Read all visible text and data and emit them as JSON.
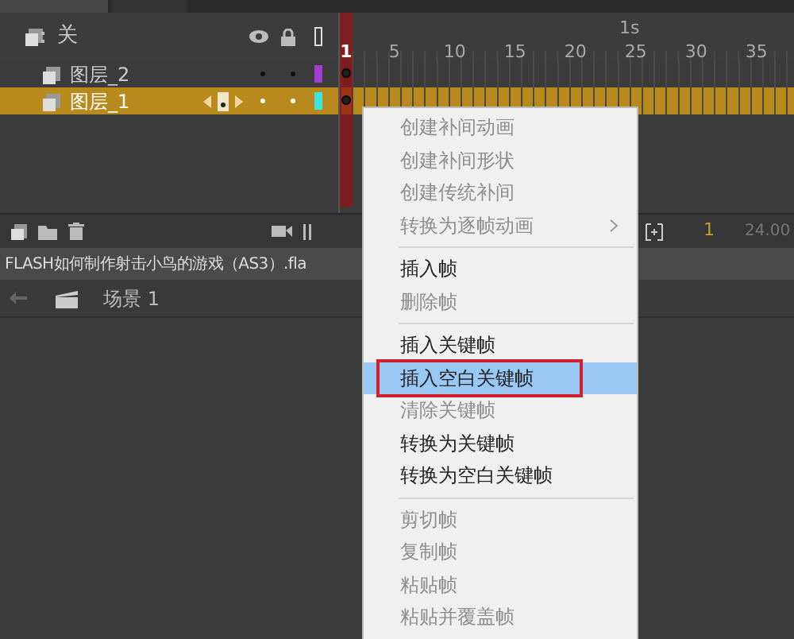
{
  "timeline": {
    "header_label": "关",
    "ruler": {
      "seconds_label": "1s",
      "frame_numbers": [
        "1",
        "5",
        "10",
        "15",
        "20",
        "25",
        "30",
        "35"
      ]
    },
    "layers": [
      {
        "name": "图层_2",
        "selected": false,
        "color": "#a23fd0"
      },
      {
        "name": "图层_1",
        "selected": true,
        "color": "#3fe3dc"
      }
    ],
    "toolbar": {
      "current_frame": "1",
      "frame_rate": "24.00"
    }
  },
  "document": {
    "title": "FLASH如何制作射击小鸟的游戏（AS3）.fla"
  },
  "breadcrumb": {
    "scene": "场景 1"
  },
  "context_menu": {
    "items": [
      {
        "kind": "item",
        "label": "创建补间动画",
        "disabled": true,
        "selected": false
      },
      {
        "kind": "item",
        "label": "创建补间形状",
        "disabled": true,
        "selected": false
      },
      {
        "kind": "item",
        "label": "创建传统补间",
        "disabled": true,
        "selected": false
      },
      {
        "kind": "submenu",
        "label": "转换为逐帧动画",
        "disabled": true,
        "selected": false
      },
      {
        "kind": "separator"
      },
      {
        "kind": "item",
        "label": "插入帧",
        "disabled": false,
        "selected": false
      },
      {
        "kind": "item",
        "label": "删除帧",
        "disabled": true,
        "selected": false
      },
      {
        "kind": "separator"
      },
      {
        "kind": "item",
        "label": "插入关键帧",
        "disabled": false,
        "selected": false
      },
      {
        "kind": "item",
        "label": "插入空白关键帧",
        "disabled": false,
        "selected": true
      },
      {
        "kind": "item",
        "label": "清除关键帧",
        "disabled": true,
        "selected": false
      },
      {
        "kind": "item",
        "label": "转换为关键帧",
        "disabled": false,
        "selected": false
      },
      {
        "kind": "item",
        "label": "转换为空白关键帧",
        "disabled": false,
        "selected": false
      },
      {
        "kind": "separator"
      },
      {
        "kind": "item",
        "label": "剪切帧",
        "disabled": true,
        "selected": false
      },
      {
        "kind": "item",
        "label": "复制帧",
        "disabled": true,
        "selected": false
      },
      {
        "kind": "item",
        "label": "粘贴帧",
        "disabled": true,
        "selected": false
      },
      {
        "kind": "item",
        "label": "粘贴并覆盖帧",
        "disabled": true,
        "selected": false
      }
    ]
  }
}
